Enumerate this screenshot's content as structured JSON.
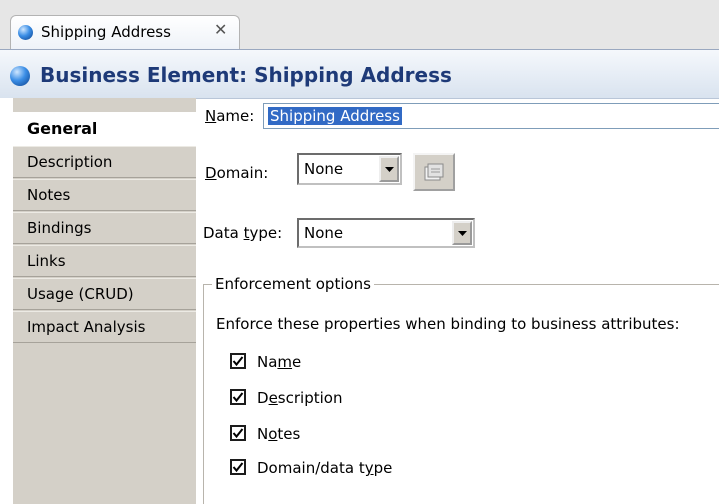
{
  "tab": {
    "label": "Shipping Address"
  },
  "header": {
    "title": "Business Element: Shipping Address"
  },
  "nav": {
    "items": [
      {
        "label": "General",
        "active": true
      },
      {
        "label": "Description"
      },
      {
        "label": "Notes"
      },
      {
        "label": "Bindings"
      },
      {
        "label": "Links"
      },
      {
        "label": "Usage (CRUD)"
      },
      {
        "label": "Impact Analysis"
      }
    ]
  },
  "form": {
    "name": {
      "label_pre": "",
      "label_mn": "N",
      "label_post": "ame:",
      "value": "Shipping Address"
    },
    "domain": {
      "label_mn": "D",
      "label_post": "omain:",
      "value": "None"
    },
    "data_type": {
      "label_pre": "Data ",
      "label_mn": "t",
      "label_post": "ype:",
      "value": "None"
    }
  },
  "enforcement": {
    "title": "Enforcement options",
    "description": "Enforce these properties when binding to business attributes:",
    "options": [
      {
        "pre": "Na",
        "mn": "m",
        "post": "e",
        "checked": true
      },
      {
        "pre": "D",
        "mn": "e",
        "post": "scription",
        "checked": true
      },
      {
        "pre": "N",
        "mn": "o",
        "post": "tes",
        "checked": true
      },
      {
        "pre": "Domain/data t",
        "mn": "y",
        "post": "pe",
        "checked": true
      }
    ]
  },
  "colors": {
    "header_title": "#1e3a78",
    "selection": "#316ac5",
    "nav_bg": "#d4d0c8"
  },
  "icons": {
    "tab": "blue-ball-icon",
    "close": "close-x-icon",
    "domain_button": "domain-browse-icon"
  }
}
